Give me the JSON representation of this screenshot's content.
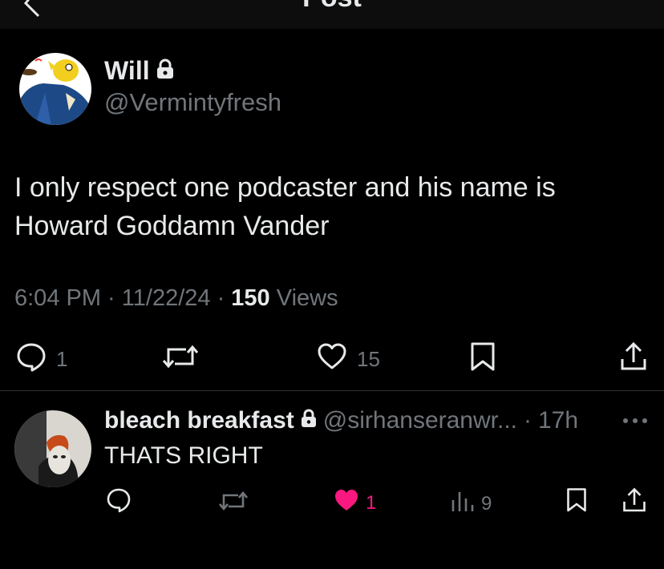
{
  "header": {
    "title": "Post"
  },
  "post": {
    "author_name": "Will",
    "author_handle": "@Vermintyfresh",
    "text": "I only respect one podcaster and his name is Howard Goddamn Vander",
    "time": "6:04 PM",
    "date": "11/22/24",
    "views_count": "150",
    "views_label": "Views",
    "replies": "1",
    "likes": "15"
  },
  "reply": {
    "author_name": "bleach breakfast",
    "author_handle": "@sirhanseranwr...",
    "age": "17h",
    "text": "THATS RIGHT",
    "likes": "1",
    "views": "9"
  },
  "colors": {
    "background": "#000000",
    "text": "#e7e9ea",
    "muted": "#71767b",
    "like": "#f91880"
  },
  "icons": [
    "back-arrow-icon",
    "lock-icon",
    "reply-icon",
    "repost-icon",
    "heart-icon",
    "bookmark-icon",
    "share-icon",
    "views-icon",
    "more-icon"
  ]
}
